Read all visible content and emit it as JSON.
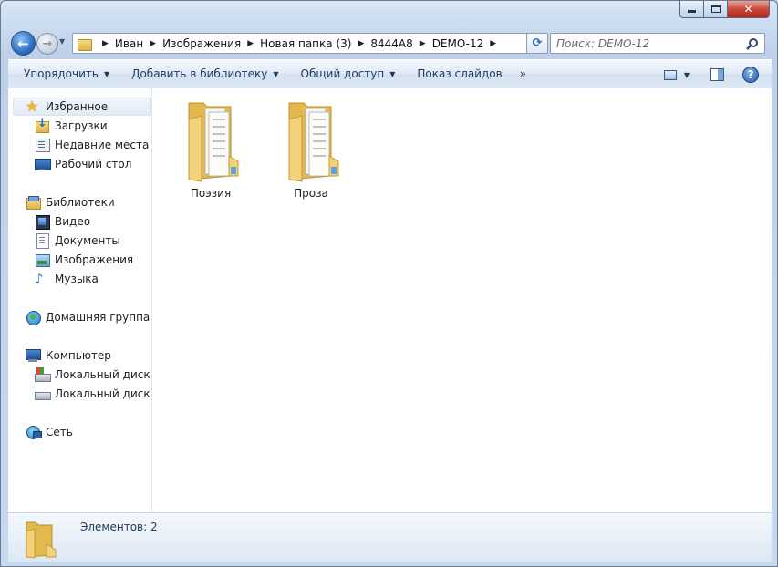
{
  "window": {
    "minimize_glyph": "—",
    "close_glyph": "✕"
  },
  "nav": {
    "back_glyph": "←",
    "forward_glyph": "→",
    "recent_glyph": "▼",
    "refresh_glyph": "⟳"
  },
  "address": {
    "breadcrumbs": [
      "Иван",
      "Изображения",
      "Новая папка (3)",
      "8444A8",
      "DEMO-12"
    ],
    "separator_glyph": "▶",
    "dropdown_glyph": "▼"
  },
  "search": {
    "placeholder": "Поиск: DEMO-12"
  },
  "toolbar": {
    "items": [
      {
        "label": "Упорядочить",
        "caret": "▼"
      },
      {
        "label": "Добавить в библиотеку",
        "caret": "▼"
      },
      {
        "label": "Общий доступ",
        "caret": "▼"
      },
      {
        "label": "Показ слайдов",
        "caret": ""
      }
    ],
    "more_glyph": "»",
    "view_caret": "▼",
    "help_glyph": "?"
  },
  "sidebar": {
    "favorites": {
      "label": "Избранное",
      "icon": "star-icon"
    },
    "favorites_items": [
      {
        "label": "Загрузки",
        "icon": "downloads-icon"
      },
      {
        "label": "Недавние места",
        "icon": "recent-places-icon"
      },
      {
        "label": "Рабочий стол",
        "icon": "desktop-icon"
      }
    ],
    "libraries": {
      "label": "Библиотеки",
      "icon": "libraries-icon"
    },
    "libraries_items": [
      {
        "label": "Видео",
        "icon": "video-icon"
      },
      {
        "label": "Документы",
        "icon": "documents-icon"
      },
      {
        "label": "Изображения",
        "icon": "pictures-icon"
      },
      {
        "label": "Музыка",
        "icon": "music-icon"
      }
    ],
    "homegroup": {
      "label": "Домашняя группа",
      "icon": "homegroup-icon"
    },
    "computer": {
      "label": "Компьютер",
      "icon": "computer-icon"
    },
    "computer_items": [
      {
        "label": "Локальный диск (C:)",
        "icon": "disk-c-icon"
      },
      {
        "label": "Локальный диск (D:)",
        "icon": "disk-d-icon"
      }
    ],
    "network": {
      "label": "Сеть",
      "icon": "network-icon"
    }
  },
  "content": {
    "folders": [
      {
        "name": "Поэзия"
      },
      {
        "name": "Проза"
      }
    ]
  },
  "status": {
    "text": "Элементов: 2"
  },
  "colors": {
    "accent": "#2c6fc4",
    "folder": "#f2d27a",
    "toolbar_text": "#1e395b"
  }
}
